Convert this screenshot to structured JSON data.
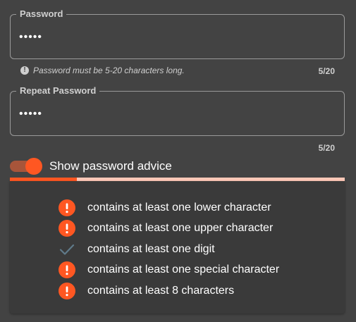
{
  "password_field": {
    "label": "Password",
    "value": "•••••",
    "hint": "Password must be 5-20 characters long.",
    "counter": "5/20"
  },
  "repeat_field": {
    "label": "Repeat Password",
    "value": "•••••",
    "counter": "5/20"
  },
  "advice_toggle": {
    "label": "Show password advice",
    "on": true
  },
  "strength": {
    "fraction": 0.2
  },
  "colors": {
    "accent": "#ff5722",
    "accent_light": "#ffc9b8",
    "check": "#5f7a8a",
    "background": "#434343"
  },
  "advice": [
    {
      "text": "contains at least one lower character",
      "status": "error",
      "icon": "exclamation-circle-icon"
    },
    {
      "text": "contains at least one upper character",
      "status": "error",
      "icon": "exclamation-circle-icon"
    },
    {
      "text": "contains at least one digit",
      "status": "ok",
      "icon": "check-icon"
    },
    {
      "text": "contains at least one special character",
      "status": "error",
      "icon": "exclamation-circle-icon"
    },
    {
      "text": "contains at least 8 characters",
      "status": "error",
      "icon": "exclamation-circle-icon"
    }
  ]
}
